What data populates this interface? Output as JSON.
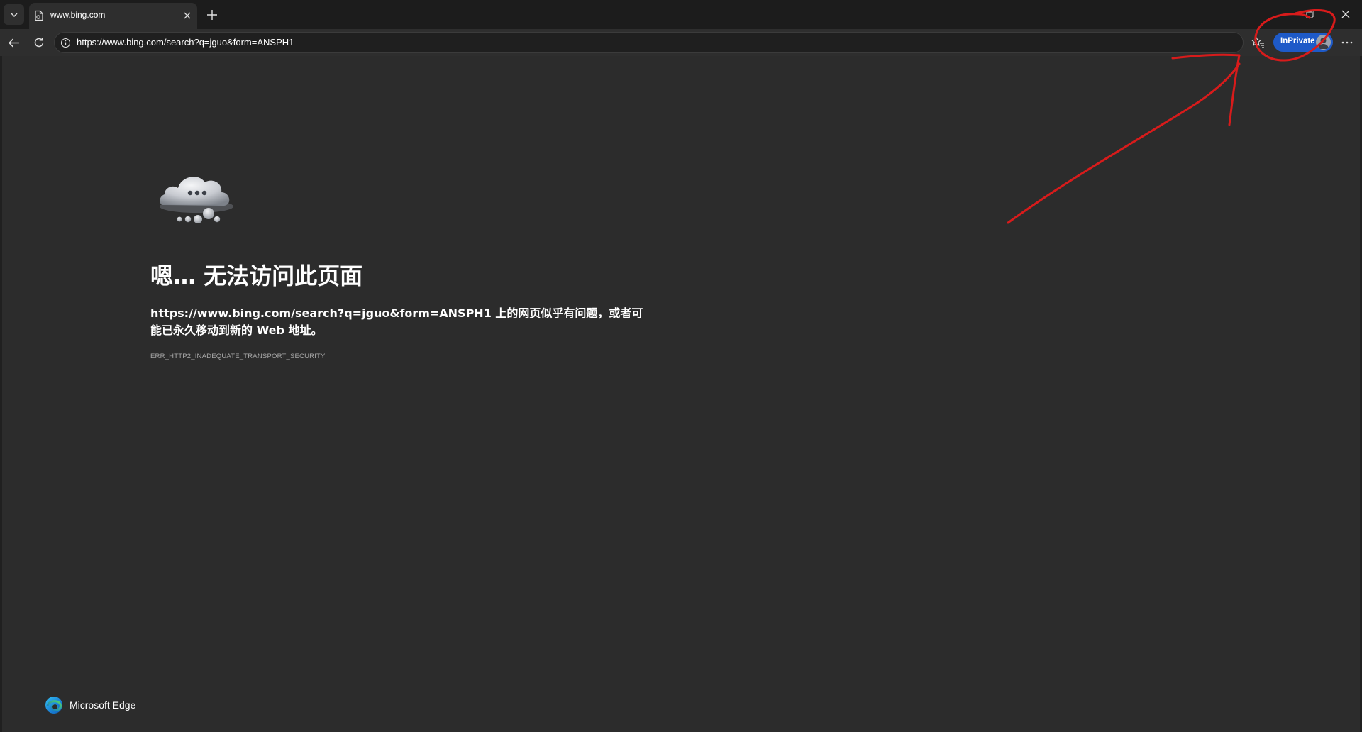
{
  "tab": {
    "title": "www.bing.com"
  },
  "toolbar": {
    "url": "https://www.bing.com/search?q=jguo&form=ANSPH1",
    "inprivate_label": "InPrivate"
  },
  "error": {
    "heading": "嗯… 无法访问此页面",
    "message": "https://www.bing.com/search?q=jguo&form=ANSPH1 上的网页似乎有问题，或者可能已永久移动到新的 Web 地址。",
    "code": "ERR_HTTP2_INADEQUATE_TRANSPORT_SECURITY"
  },
  "footer": {
    "brand": "Microsoft Edge"
  },
  "colors": {
    "inprivate_accent": "#1e5ac8",
    "annotation": "#d81b1b",
    "page_background": "#2c2c2c"
  },
  "icons": {
    "tab_actions": "chevron-down-icon",
    "favicon": "page-icon",
    "tab_close": "close-icon",
    "new_tab": "plus-icon",
    "back": "arrow-left-icon",
    "refresh": "refresh-icon",
    "site_info": "info-icon",
    "favorite": "star-icon",
    "favorites": "favorites-icon",
    "more": "more-icon",
    "restore": "restore-icon",
    "window_close": "close-icon"
  }
}
